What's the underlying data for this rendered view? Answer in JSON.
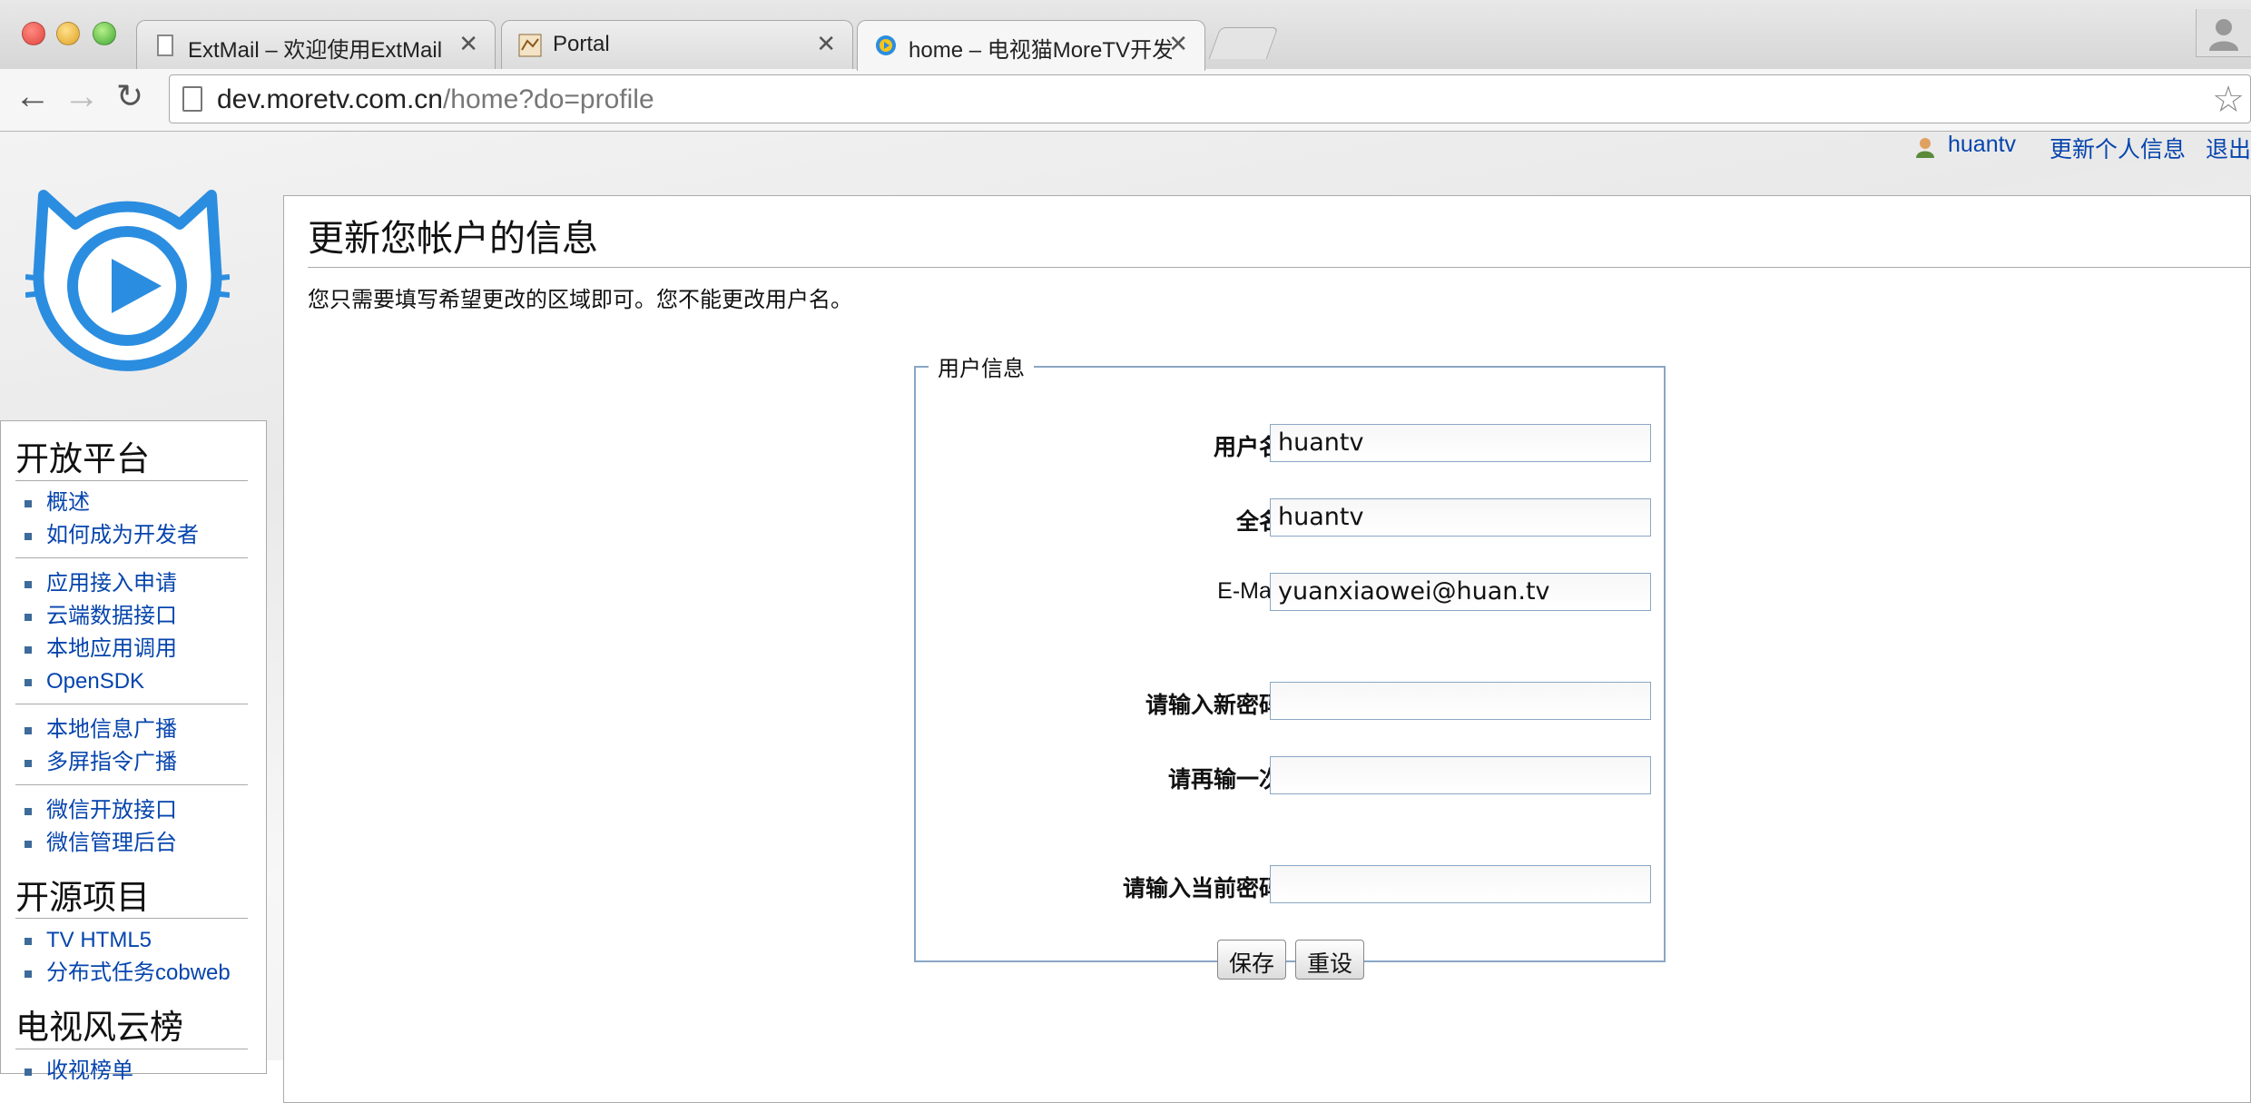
{
  "browser": {
    "tabs": [
      {
        "title": "ExtMail – 欢迎使用ExtMail",
        "close": "✕"
      },
      {
        "title": "Portal",
        "close": "✕"
      },
      {
        "title": "home – 电视猫MoreTV开发",
        "close": "✕"
      }
    ],
    "url_host": "dev.moretv.com.cn",
    "url_path": "/home?do=profile"
  },
  "userbar": {
    "username": "huantv",
    "update_link": "更新个人信息",
    "logout": "退出"
  },
  "sidebar": {
    "sections": [
      {
        "heading": "开放平台"
      },
      {
        "heading": "开源项目"
      },
      {
        "heading": "电视风云榜"
      }
    ],
    "group1": [
      "概述",
      "如何成为开发者"
    ],
    "group2": [
      "应用接入申请",
      "云端数据接口",
      "本地应用调用",
      "OpenSDK"
    ],
    "group3": [
      "本地信息广播",
      "多屏指令广播"
    ],
    "group4": [
      "微信开放接口",
      "微信管理后台"
    ],
    "group5": [
      "TV HTML5",
      "分布式任务cobweb"
    ],
    "group6": [
      "收视榜单"
    ]
  },
  "content": {
    "heading": "更新您帐户的信息",
    "intro": "您只需要填写希望更改的区域即可。您不能更改用户名。",
    "legend": "用户信息",
    "fields": {
      "username_label": "用户名",
      "username_value": "huantv",
      "fullname_label": "全名",
      "fullname_value": "huantv",
      "email_label": "E-Mail",
      "email_value": "yuanxiaowei@huan.tv",
      "newpass_label": "请输入新密码",
      "repeat_label": "请再输一次",
      "current_label": "请输入当前密码"
    },
    "save": "保存",
    "reset": "重设"
  }
}
